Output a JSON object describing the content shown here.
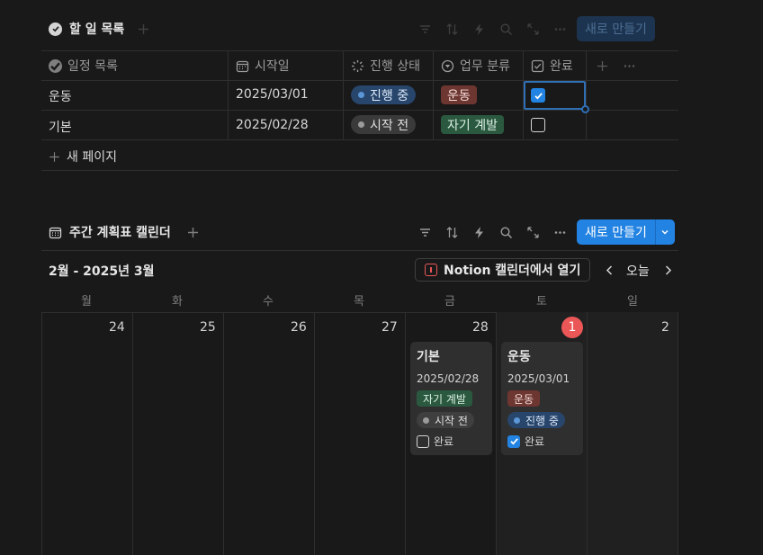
{
  "colors": {
    "background": "#191919",
    "accent": "#2383e2",
    "tag_exercise": "#6e3630",
    "tag_growth": "#2b593f",
    "status_in_progress": "#28456c",
    "status_not_started": "#3a3a3a",
    "today_badge": "#eb5757"
  },
  "todo_db": {
    "title": "할 일 목록",
    "title_icon": "check-circle-icon",
    "new_label": "새로 만들기",
    "toolbar_icons": [
      "filter-icon",
      "sort-icon",
      "lightning-icon",
      "search-icon",
      "expand-icon",
      "more-icon"
    ],
    "columns": [
      {
        "label": "일정 목록",
        "icon": "check-circle-icon"
      },
      {
        "label": "시작일",
        "icon": "calendar-icon"
      },
      {
        "label": "진행 상태",
        "icon": "status-icon"
      },
      {
        "label": "업무 분류",
        "icon": "select-icon"
      },
      {
        "label": "완료",
        "icon": "checkbox-icon"
      }
    ],
    "rows": [
      {
        "name": "운동",
        "start": "2025/03/01",
        "status": "진행 중",
        "category": "운동",
        "done": true
      },
      {
        "name": "기본",
        "start": "2025/02/28",
        "status": "시작 전",
        "category": "자기 계발",
        "done": false
      }
    ],
    "new_page": "새 페이지"
  },
  "calendar": {
    "title": "주간 계획표 캘린더",
    "title_icon": "calendar-icon",
    "new_label": "새로 만들기",
    "range_label": "2월 - 2025년 3월",
    "open_notion": "Notion 캘린더에서 열기",
    "today_label": "오늘",
    "weekdays": [
      "월",
      "화",
      "수",
      "목",
      "금",
      "토",
      "일"
    ],
    "days": [
      "24",
      "25",
      "26",
      "27",
      "28",
      "1",
      "2"
    ],
    "cards": [
      {
        "title": "기본",
        "date": "2025/02/28",
        "category": "자기 계발",
        "status": "시작 전",
        "done_label": "완료",
        "done": false
      },
      {
        "title": "운동",
        "date": "2025/03/01",
        "category": "운동",
        "status": "진행 중",
        "done_label": "완료",
        "done": true
      }
    ]
  }
}
